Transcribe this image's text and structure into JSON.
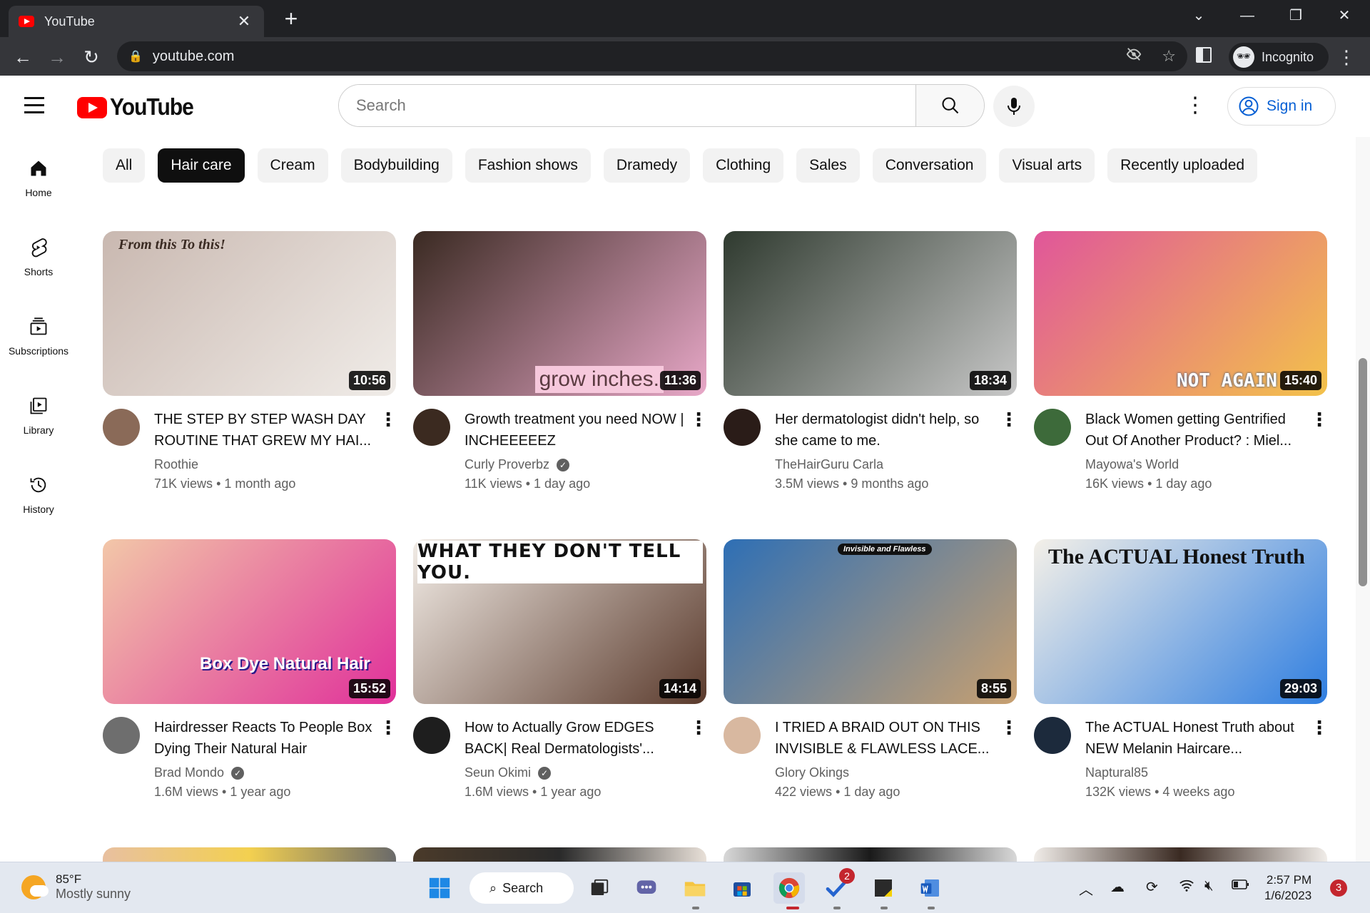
{
  "browser": {
    "tab_title": "YouTube",
    "url": "youtube.com",
    "profile_label": "Incognito"
  },
  "header": {
    "logo_text": "YouTube",
    "search_placeholder": "Search",
    "signin_label": "Sign in"
  },
  "sidebar": {
    "items": [
      {
        "label": "Home",
        "icon": "home-icon"
      },
      {
        "label": "Shorts",
        "icon": "shorts-icon"
      },
      {
        "label": "Subscriptions",
        "icon": "subscriptions-icon"
      },
      {
        "label": "Library",
        "icon": "library-icon"
      },
      {
        "label": "History",
        "icon": "history-icon"
      }
    ]
  },
  "chips": [
    "All",
    "Hair care",
    "Cream",
    "Bodybuilding",
    "Fashion shows",
    "Dramedy",
    "Clothing",
    "Sales",
    "Conversation",
    "Visual arts",
    "Recently uploaded"
  ],
  "active_chip": "Hair care",
  "videos": [
    {
      "title": "THE STEP BY STEP WASH DAY ROUTINE THAT GREW MY HAI...",
      "channel": "Roothie",
      "verified": false,
      "views": "71K views",
      "age": "1 month ago",
      "duration": "10:56",
      "thumb_text": "From this  To this!",
      "thumb_colors": [
        "#c9b8b0",
        "#f0ece8"
      ],
      "avatar_color": "#8a6a58"
    },
    {
      "title": "Growth treatment you need NOW | INCHEEEEEZ",
      "channel": "Curly Proverbz",
      "verified": true,
      "views": "11K views",
      "age": "1 day ago",
      "duration": "11:36",
      "thumb_text": "grow inches.",
      "thumb_colors": [
        "#3a2a22",
        "#e8a8c8"
      ],
      "avatar_color": "#3b2a20"
    },
    {
      "title": "Her dermatologist didn't help, so she came to me.",
      "channel": "TheHairGuru Carla",
      "verified": false,
      "views": "3.5M views",
      "age": "9 months ago",
      "duration": "18:34",
      "thumb_text": "",
      "thumb_colors": [
        "#2f3a2f",
        "#c8c8c8"
      ],
      "avatar_color": "#2a1c18"
    },
    {
      "title": "Black Women getting Gentrified Out Of Another Product? : Miel...",
      "channel": "Mayowa's World",
      "verified": false,
      "views": "16K views",
      "age": "1 day ago",
      "duration": "15:40",
      "thumb_text": "NOT AGAIN",
      "thumb_colors": [
        "#e0569a",
        "#f3c24a"
      ],
      "avatar_color": "#3d6a3a"
    },
    {
      "title": "Hairdresser Reacts To People Box Dying Their Natural Hair",
      "channel": "Brad Mondo",
      "verified": true,
      "views": "1.6M views",
      "age": "1 year ago",
      "duration": "15:52",
      "thumb_text": "Box Dye Natural Hair",
      "thumb_colors": [
        "#f2c7a8",
        "#e0309a"
      ],
      "avatar_color": "#6e6e6e"
    },
    {
      "title": "How to Actually Grow EDGES BACK| Real Dermatologists'...",
      "channel": "Seun Okimi",
      "verified": true,
      "views": "1.6M views",
      "age": "1 year ago",
      "duration": "14:14",
      "thumb_text": "WHAT THEY DON'T TELL YOU.",
      "thumb_colors": [
        "#f2ece6",
        "#5a3a2c"
      ],
      "avatar_color": "#1e1e1e"
    },
    {
      "title": "I TRIED A BRAID OUT ON THIS INVISIBLE & FLAWLESS LACE...",
      "channel": "Glory Okings",
      "verified": false,
      "views": "422 views",
      "age": "1 day ago",
      "duration": "8:55",
      "thumb_text": "Invisible and Flawless",
      "thumb_colors": [
        "#2e6fb5",
        "#c8a070"
      ],
      "avatar_color": "#d8b8a0"
    },
    {
      "title": "The ACTUAL Honest Truth about NEW Melanin Haircare...",
      "channel": "Naptural85",
      "verified": false,
      "views": "132K views",
      "age": "4 weeks ago",
      "duration": "29:03",
      "thumb_text": "The ACTUAL Honest Truth",
      "thumb_colors": [
        "#f4f0e8",
        "#2f7ee0"
      ],
      "avatar_color": "#1c2a3c"
    }
  ],
  "taskbar": {
    "weather_temp": "85°F",
    "weather_desc": "Mostly sunny",
    "search_label": "Search",
    "time": "2:57 PM",
    "date": "1/6/2023",
    "notifications": "3",
    "todo_badge": "2"
  }
}
